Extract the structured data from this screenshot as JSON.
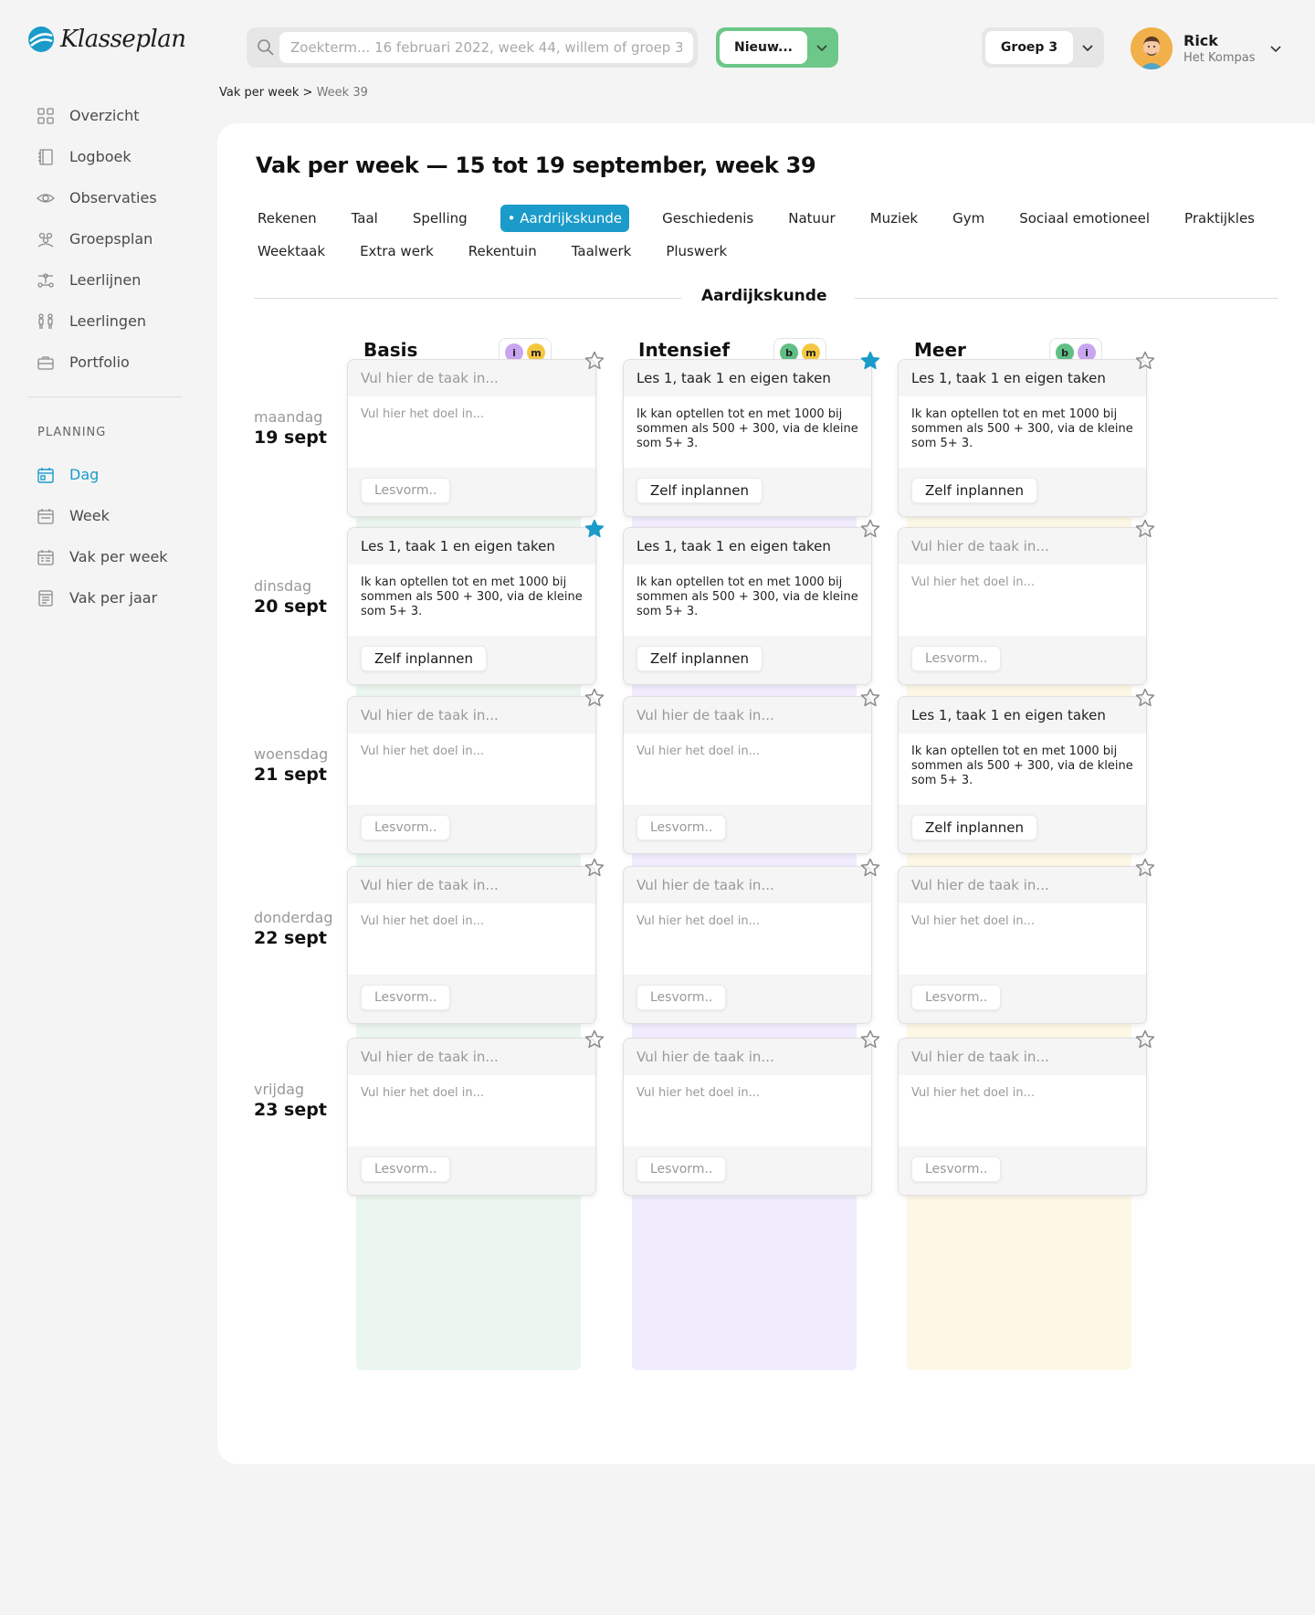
{
  "app": {
    "name": "Klasseplan"
  },
  "sidebar": {
    "items": [
      {
        "label": "Overzicht",
        "icon": "grid-icon"
      },
      {
        "label": "Logboek",
        "icon": "book-icon"
      },
      {
        "label": "Observaties",
        "icon": "eye-icon"
      },
      {
        "label": "Groepsplan",
        "icon": "group-icon"
      },
      {
        "label": "Leerlijnen",
        "icon": "path-icon"
      },
      {
        "label": "Leerlingen",
        "icon": "students-icon"
      },
      {
        "label": "Portfolio",
        "icon": "briefcase-icon"
      }
    ],
    "planning_label": "PLANNING",
    "planning_items": [
      {
        "label": "Dag",
        "icon": "calendar-day-icon",
        "active": true
      },
      {
        "label": "Week",
        "icon": "calendar-week-icon"
      },
      {
        "label": "Vak per week",
        "icon": "calendar-subject-icon"
      },
      {
        "label": "Vak per jaar",
        "icon": "calendar-year-icon"
      }
    ]
  },
  "topbar": {
    "search_label": "Zoekterm...",
    "search_placeholder": "Zoekterm... 16 februari 2022, week 44, willem of groep 3",
    "new_button": "Nieuw...",
    "group_button": "Groep 3",
    "user_name": "Rick",
    "user_school": "Het Kompas"
  },
  "breadcrumb": {
    "parent": "Vak per week",
    "separator": ">",
    "current": "Week 39"
  },
  "page": {
    "title": "Vak per week — 15 tot 19 september, week 39",
    "tabs_row1": [
      "Rekenen",
      "Taal",
      "Spelling",
      "• Aardrijkskunde",
      "Geschiedenis",
      "Natuur",
      "Muziek",
      "Gym",
      "Sociaal emotioneel",
      "Praktijkles"
    ],
    "tabs_row2": [
      "Weektaak",
      "Extra werk",
      "Rekentuin",
      "Taalwerk",
      "Pluswerk"
    ],
    "active_tab": "Aardrijkskunde",
    "section_title": "Aardijkskunde"
  },
  "columns": [
    {
      "title": "Basis",
      "badges": [
        "i",
        "m"
      ],
      "color": "#eaf6ee"
    },
    {
      "title": "Intensief",
      "badges": [
        "b",
        "m"
      ],
      "color": "#f1ecfd"
    },
    {
      "title": "Meer",
      "badges": [
        "b",
        "i"
      ],
      "color": "#fdf8e6"
    }
  ],
  "colors": {
    "accent": "#1a9bc9",
    "new_button": "#6cc788",
    "badge_i": "#c9a6f0",
    "badge_m": "#f3c740",
    "badge_b": "#5fbf86"
  },
  "days": [
    {
      "name": "maandag",
      "date": "19 sept"
    },
    {
      "name": "dinsdag",
      "date": "20 sept"
    },
    {
      "name": "woensdag",
      "date": "21 sept"
    },
    {
      "name": "donderdag",
      "date": "22 sept"
    },
    {
      "name": "vrijdag",
      "date": "23 sept"
    }
  ],
  "placeholders": {
    "task": "Vul hier de taak in...",
    "goal": "Vul hier het doel in...",
    "lesvorm": "Lesvorm.."
  },
  "filled": {
    "task": "Les 1, taak 1 en eigen taken",
    "goal": "Ik kan optellen tot en met 1000 bij sommen als 500 + 300, via de kleine som 5+ 3.",
    "lesvorm": "Zelf inplannen"
  },
  "cards": [
    [
      {
        "filled": false,
        "starred": false
      },
      {
        "filled": true,
        "starred": true
      },
      {
        "filled": true,
        "starred": false
      }
    ],
    [
      {
        "filled": true,
        "starred": true
      },
      {
        "filled": true,
        "starred": false
      },
      {
        "filled": false,
        "starred": false
      }
    ],
    [
      {
        "filled": false,
        "starred": false
      },
      {
        "filled": false,
        "starred": false
      },
      {
        "filled": true,
        "starred": false
      }
    ],
    [
      {
        "filled": false,
        "starred": false
      },
      {
        "filled": false,
        "starred": false
      },
      {
        "filled": false,
        "starred": false
      }
    ],
    [
      {
        "filled": false,
        "starred": false
      },
      {
        "filled": false,
        "starred": false
      },
      {
        "filled": false,
        "starred": false
      }
    ]
  ]
}
